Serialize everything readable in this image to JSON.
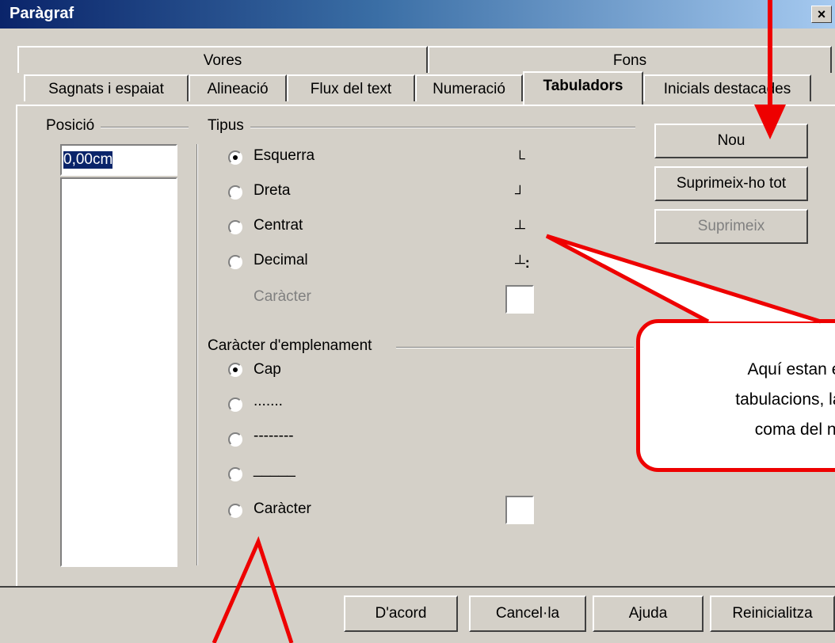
{
  "window": {
    "title": "Paràgraf",
    "close_label": "×"
  },
  "tabs_back": [
    "Vores",
    "Fons"
  ],
  "tabs_front": [
    "Sagnats i espaiat",
    "Alineació",
    "Flux del text",
    "Numeració",
    "Tabuladors",
    "Inicials destacades"
  ],
  "position": {
    "label": "Posició",
    "value": "0,00cm"
  },
  "type": {
    "label": "Tipus",
    "options": [
      "Esquerra",
      "Dreta",
      "Centrat",
      "Decimal"
    ],
    "selected": 0,
    "icons": [
      "tab-left-icon",
      "tab-right-icon",
      "tab-center-icon",
      "tab-decimal-icon"
    ],
    "character_label": "Caràcter"
  },
  "fill": {
    "label": "Caràcter d'emplenament",
    "options": [
      "Cap",
      ".......",
      "--------",
      "_____",
      "Caràcter"
    ],
    "selected": 0
  },
  "side_buttons": {
    "new": "Nou",
    "delete_all": "Suprimeix-ho tot",
    "delete": "Suprimeix"
  },
  "footer_buttons": {
    "ok": "D'acord",
    "cancel": "Cancel·la",
    "help": "Ajuda",
    "reset": "Reinicialitza"
  },
  "callout": {
    "line1": "Aquí estan els",
    "line2": "tabulacions, la de",
    "line3": "coma del nú"
  },
  "colors": {
    "annotation": "#e00000",
    "titlebar": "#0a246a"
  }
}
